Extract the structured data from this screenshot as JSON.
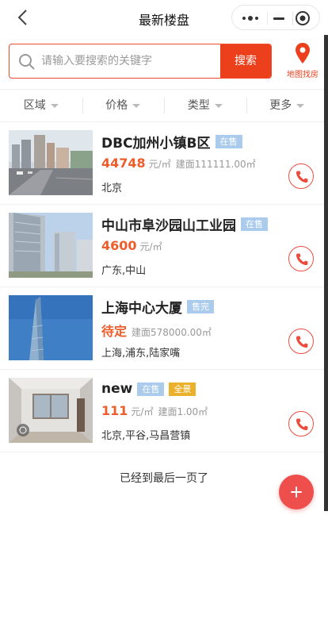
{
  "header": {
    "title": "最新楼盘"
  },
  "search": {
    "placeholder": "请输入要搜索的关键字",
    "button_label": "搜索",
    "map_label": "地图找房"
  },
  "filters": [
    {
      "label": "区域"
    },
    {
      "label": "价格"
    },
    {
      "label": "类型"
    },
    {
      "label": "更多"
    }
  ],
  "listings": [
    {
      "name": "DBC加州小镇B区",
      "tags": [
        {
          "text": "在售",
          "kind": "sale"
        }
      ],
      "price": "44748",
      "unit": "元/㎡",
      "area": "建面111111.00㎡",
      "location": "北京",
      "image": "street-buildings"
    },
    {
      "name": "中山市阜沙园山工业园",
      "tags": [
        {
          "text": "在售",
          "kind": "sale"
        }
      ],
      "price": "4600",
      "unit": "元/㎡",
      "area": "",
      "location": "广东,中山",
      "image": "office-tower"
    },
    {
      "name": "上海中心大厦",
      "tags": [
        {
          "text": "售完",
          "kind": "sold"
        }
      ],
      "price": "待定",
      "unit": "",
      "area": "建面578000.00㎡",
      "location": "上海,浦东,陆家嘴",
      "image": "skyscraper"
    },
    {
      "name": "new",
      "tags": [
        {
          "text": "在售",
          "kind": "sale"
        },
        {
          "text": "全景",
          "kind": "vr"
        }
      ],
      "price": "111",
      "unit": "元/㎡",
      "area": "建面1.00㎡",
      "location": "北京,平谷,马昌营镇",
      "image": "interior-room"
    }
  ],
  "footer": {
    "end_text": "已经到最后一页了"
  },
  "colors": {
    "accent": "#ec3f1c",
    "price": "#ec5d2a",
    "tag_sale": "#aacbec",
    "tag_vr": "#ecb12c",
    "fab": "#ef4f4c"
  }
}
